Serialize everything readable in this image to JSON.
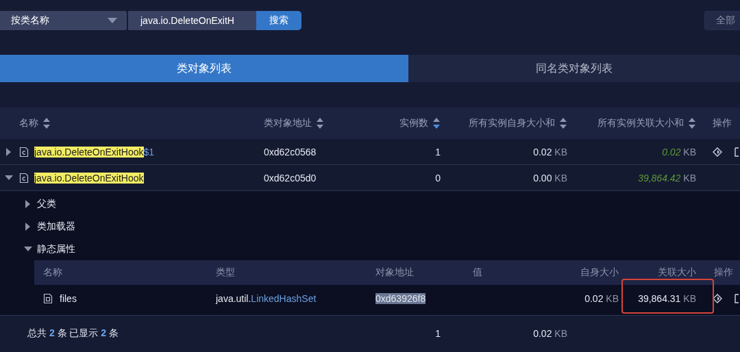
{
  "search": {
    "filter": "按类名称",
    "value": "java.io.DeleteOnExitH",
    "button": "搜索",
    "right_button": "全部"
  },
  "tabs": [
    {
      "label": "类对象列表",
      "selected": true
    },
    {
      "label": "同名类对象列表",
      "selected": false
    }
  ],
  "table": {
    "columns": [
      {
        "label": "名称",
        "kind": "sortable",
        "sorted": false
      },
      {
        "label": "类对象地址",
        "kind": "sortable",
        "sorted": false
      },
      {
        "label": "实例数",
        "kind": "sortable",
        "sorted": true
      },
      {
        "label": "所有实例自身大小和",
        "kind": "sortable",
        "sorted": false
      },
      {
        "label": "所有实例关联大小和",
        "kind": "sortable",
        "sorted": false
      },
      {
        "label": "操作",
        "kind": "plain"
      }
    ],
    "rows": [
      {
        "match": "java.io.DeleteOnExitHook",
        "suffix": "$1",
        "expanded": false,
        "address": "0xd62c0568",
        "count": "1",
        "self": "0.02",
        "self_unit": "KB",
        "retained": "0.02",
        "retained_unit": "KB",
        "actions": true
      },
      {
        "match": "java.io.DeleteOnExitHook",
        "expanded": true,
        "address": "0xd62c05d0",
        "count": "0",
        "self": "0.00",
        "self_unit": "KB",
        "retained": "39,864.42",
        "retained_unit": "KB",
        "actions": false,
        "sections": [
          {
            "label": "父类",
            "expanded": false
          },
          {
            "label": "类加载器",
            "expanded": false
          },
          {
            "label": "静态属性",
            "expanded": true,
            "columns": [
              "名称",
              "类型",
              "对象地址",
              "值",
              "自身大小",
              "关联大小",
              "操作"
            ],
            "fields": [
              {
                "name": "files",
                "type_package": "java.util.",
                "type_class": "LinkedHashSet",
                "address": "0xd63926f8",
                "address_selected": true,
                "self": "0.02",
                "self_unit": "KB",
                "retained": "39,864.31",
                "retained_unit": "KB",
                "highlighted": true,
                "actions": true
              }
            ]
          }
        ]
      }
    ]
  },
  "footer": {
    "summary": "总共 **2** 条 已显示 **2** 条",
    "count": "1",
    "self": "0.02",
    "self_unit": "KB"
  }
}
